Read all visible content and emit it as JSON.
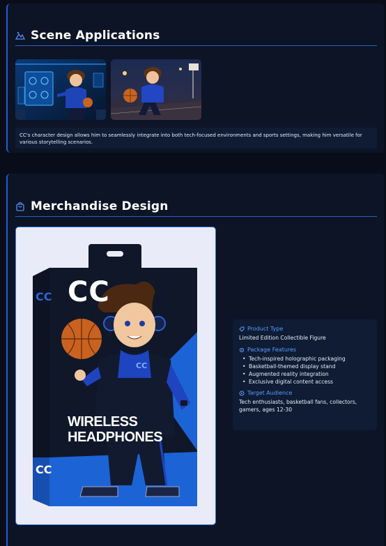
{
  "scene": {
    "title": "Scene Applications",
    "caption": "CC's character design allows him to seamlessly integrate into both tech-focused environments and sports settings, making him versatile for various storytelling scenarios."
  },
  "merch": {
    "title": "Merchandise Design",
    "box_brand": "CC",
    "box_hoodie_logo": "CC",
    "box_side_logo": "CC",
    "box_side_logo_bottom": "CC",
    "box_product_line1": "WIRELESS",
    "box_product_line2": "HEADPHONES",
    "product_type_label": "Product Type",
    "product_type_value": "Limited Edition Collectible Figure",
    "package_features_label": "Package Features",
    "package_features": [
      "Tech-inspired holographic packaging",
      "Basketball-themed display stand",
      "Augmented reality integration",
      "Exclusive digital content access"
    ],
    "target_audience_label": "Target Audience",
    "target_audience_value": "Tech enthusiasts, basketball fans, collectors, gamers, ages 12-30"
  },
  "colors": {
    "background": "#080d19",
    "panel": "#0c1426",
    "accent": "#1d5fd6",
    "label_blue": "#5c9bff"
  }
}
